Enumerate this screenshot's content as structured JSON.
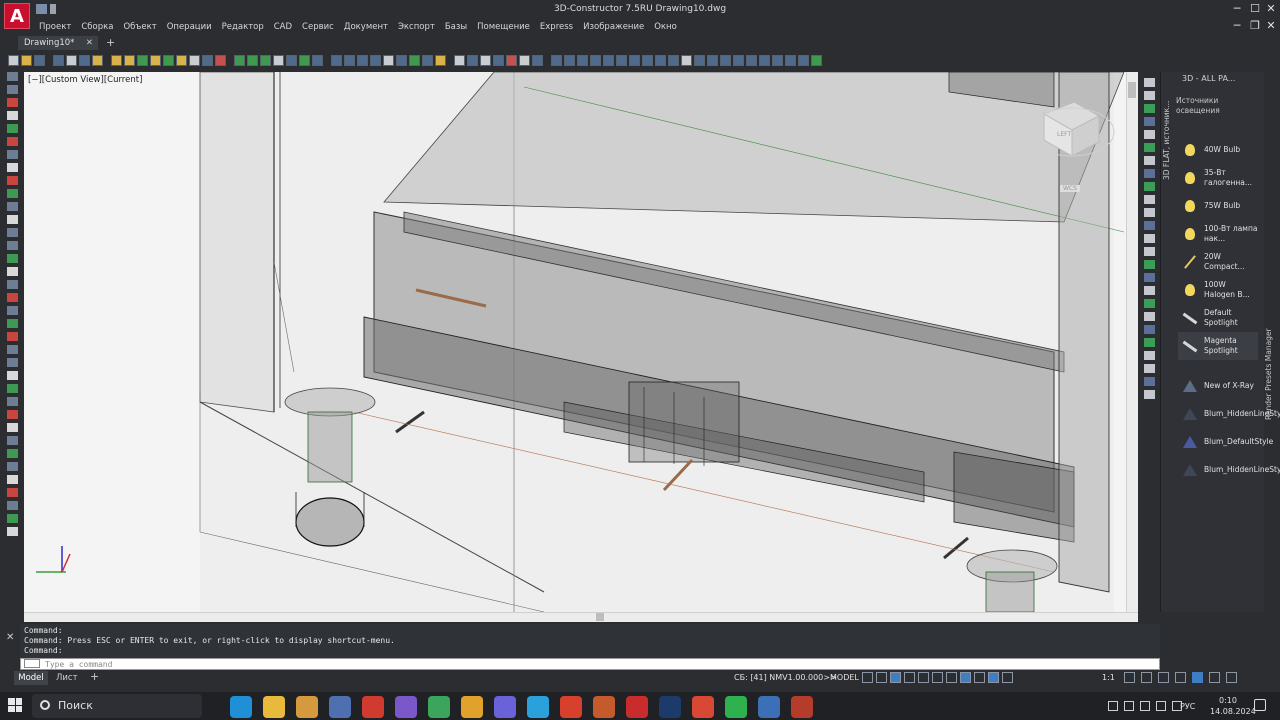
{
  "app": {
    "title": "3D-Constructor 7.5RU   Drawing10.dwg",
    "logo": "A",
    "window_controls": [
      "─",
      "☐",
      "✕"
    ],
    "inner_controls": [
      "─",
      "❐",
      "✕"
    ]
  },
  "menu": [
    "Проект",
    "Сборка",
    "Объект",
    "Операции",
    "Редактор",
    "CAD",
    "Сервис",
    "Документ",
    "Экспорт",
    "Базы",
    "Помещение",
    "Express",
    "Изображение",
    "Окно"
  ],
  "tabs": {
    "active": "Drawing10*",
    "close": "✕",
    "new": "+"
  },
  "viewport": {
    "label": "[−][Custom View][Current]",
    "viewcube_face": "LEFT",
    "wcs": "WCS"
  },
  "palette": {
    "header": "3D - ALL PA...",
    "vertical_label": "3D FLAT, источник...",
    "section": "Источники освещения",
    "items": [
      {
        "label": "40W Bulb",
        "icon": "bulb-icon"
      },
      {
        "label": "35-Вт галогенна...",
        "icon": "bulb-icon"
      },
      {
        "label": "75W Bulb",
        "icon": "bulb-icon"
      },
      {
        "label": "100-Вт лампа нак...",
        "icon": "bulb-icon"
      },
      {
        "label": "20W Compact...",
        "icon": "tube-icon"
      },
      {
        "label": "100W Halogen B...",
        "icon": "bulb-icon"
      },
      {
        "label": "Default Spotlight",
        "icon": "spotlight-icon"
      },
      {
        "label": "Magenta Spotlight",
        "icon": "spotlight-icon"
      },
      {
        "label": "New of X-Ray",
        "icon": "visual-style-icon"
      },
      {
        "label": "Blum_HiddenLineStyle",
        "icon": "visual-style-icon"
      },
      {
        "label": "Blum_DefaultStyle",
        "icon": "visual-style-icon"
      },
      {
        "label": "Blum_HiddenLineStyle2",
        "icon": "visual-style-icon"
      }
    ],
    "side_label": "Render Presets Manager"
  },
  "command": {
    "history": [
      "Command:",
      "Command:  Press ESC or ENTER to exit, or right-click to display shortcut-menu.",
      "Command:"
    ],
    "placeholder": "Type a command"
  },
  "layout_tabs": {
    "model": "Model",
    "sheet": "Лист",
    "add": "+"
  },
  "status": {
    "sb": "СБ: [41] NMV1.00.000>>",
    "mode": "MODEL",
    "scale": "1:1"
  },
  "taskbar": {
    "search": "Поиск",
    "lang": "РУС",
    "time": "0:10",
    "date": "14.08.2024",
    "apps": [
      {
        "name": "edge",
        "color": "#1f8fd6"
      },
      {
        "name": "explorer",
        "color": "#e8b93b"
      },
      {
        "name": "media",
        "color": "#d49a3d"
      },
      {
        "name": "calculator",
        "color": "#4e6fb0"
      },
      {
        "name": "acrobat",
        "color": "#d13a2e"
      },
      {
        "name": "viber",
        "color": "#7b58c9"
      },
      {
        "name": "chrome",
        "color": "#3ba55c"
      },
      {
        "name": "browser",
        "color": "#e0a22b"
      },
      {
        "name": "vpn",
        "color": "#6a62d8"
      },
      {
        "name": "telegram",
        "color": "#2aa1da"
      },
      {
        "name": "anydesk",
        "color": "#d8402e"
      },
      {
        "name": "app-settings",
        "color": "#c55b2c"
      },
      {
        "name": "acrobat2",
        "color": "#c92c2c"
      },
      {
        "name": "photoshop",
        "color": "#1c3b6b"
      },
      {
        "name": "grid-app",
        "color": "#d84834"
      },
      {
        "name": "whatsapp",
        "color": "#2fb14f"
      },
      {
        "name": "remote",
        "color": "#3b6fb6"
      },
      {
        "name": "autocad",
        "color": "#b53b2b"
      }
    ]
  }
}
